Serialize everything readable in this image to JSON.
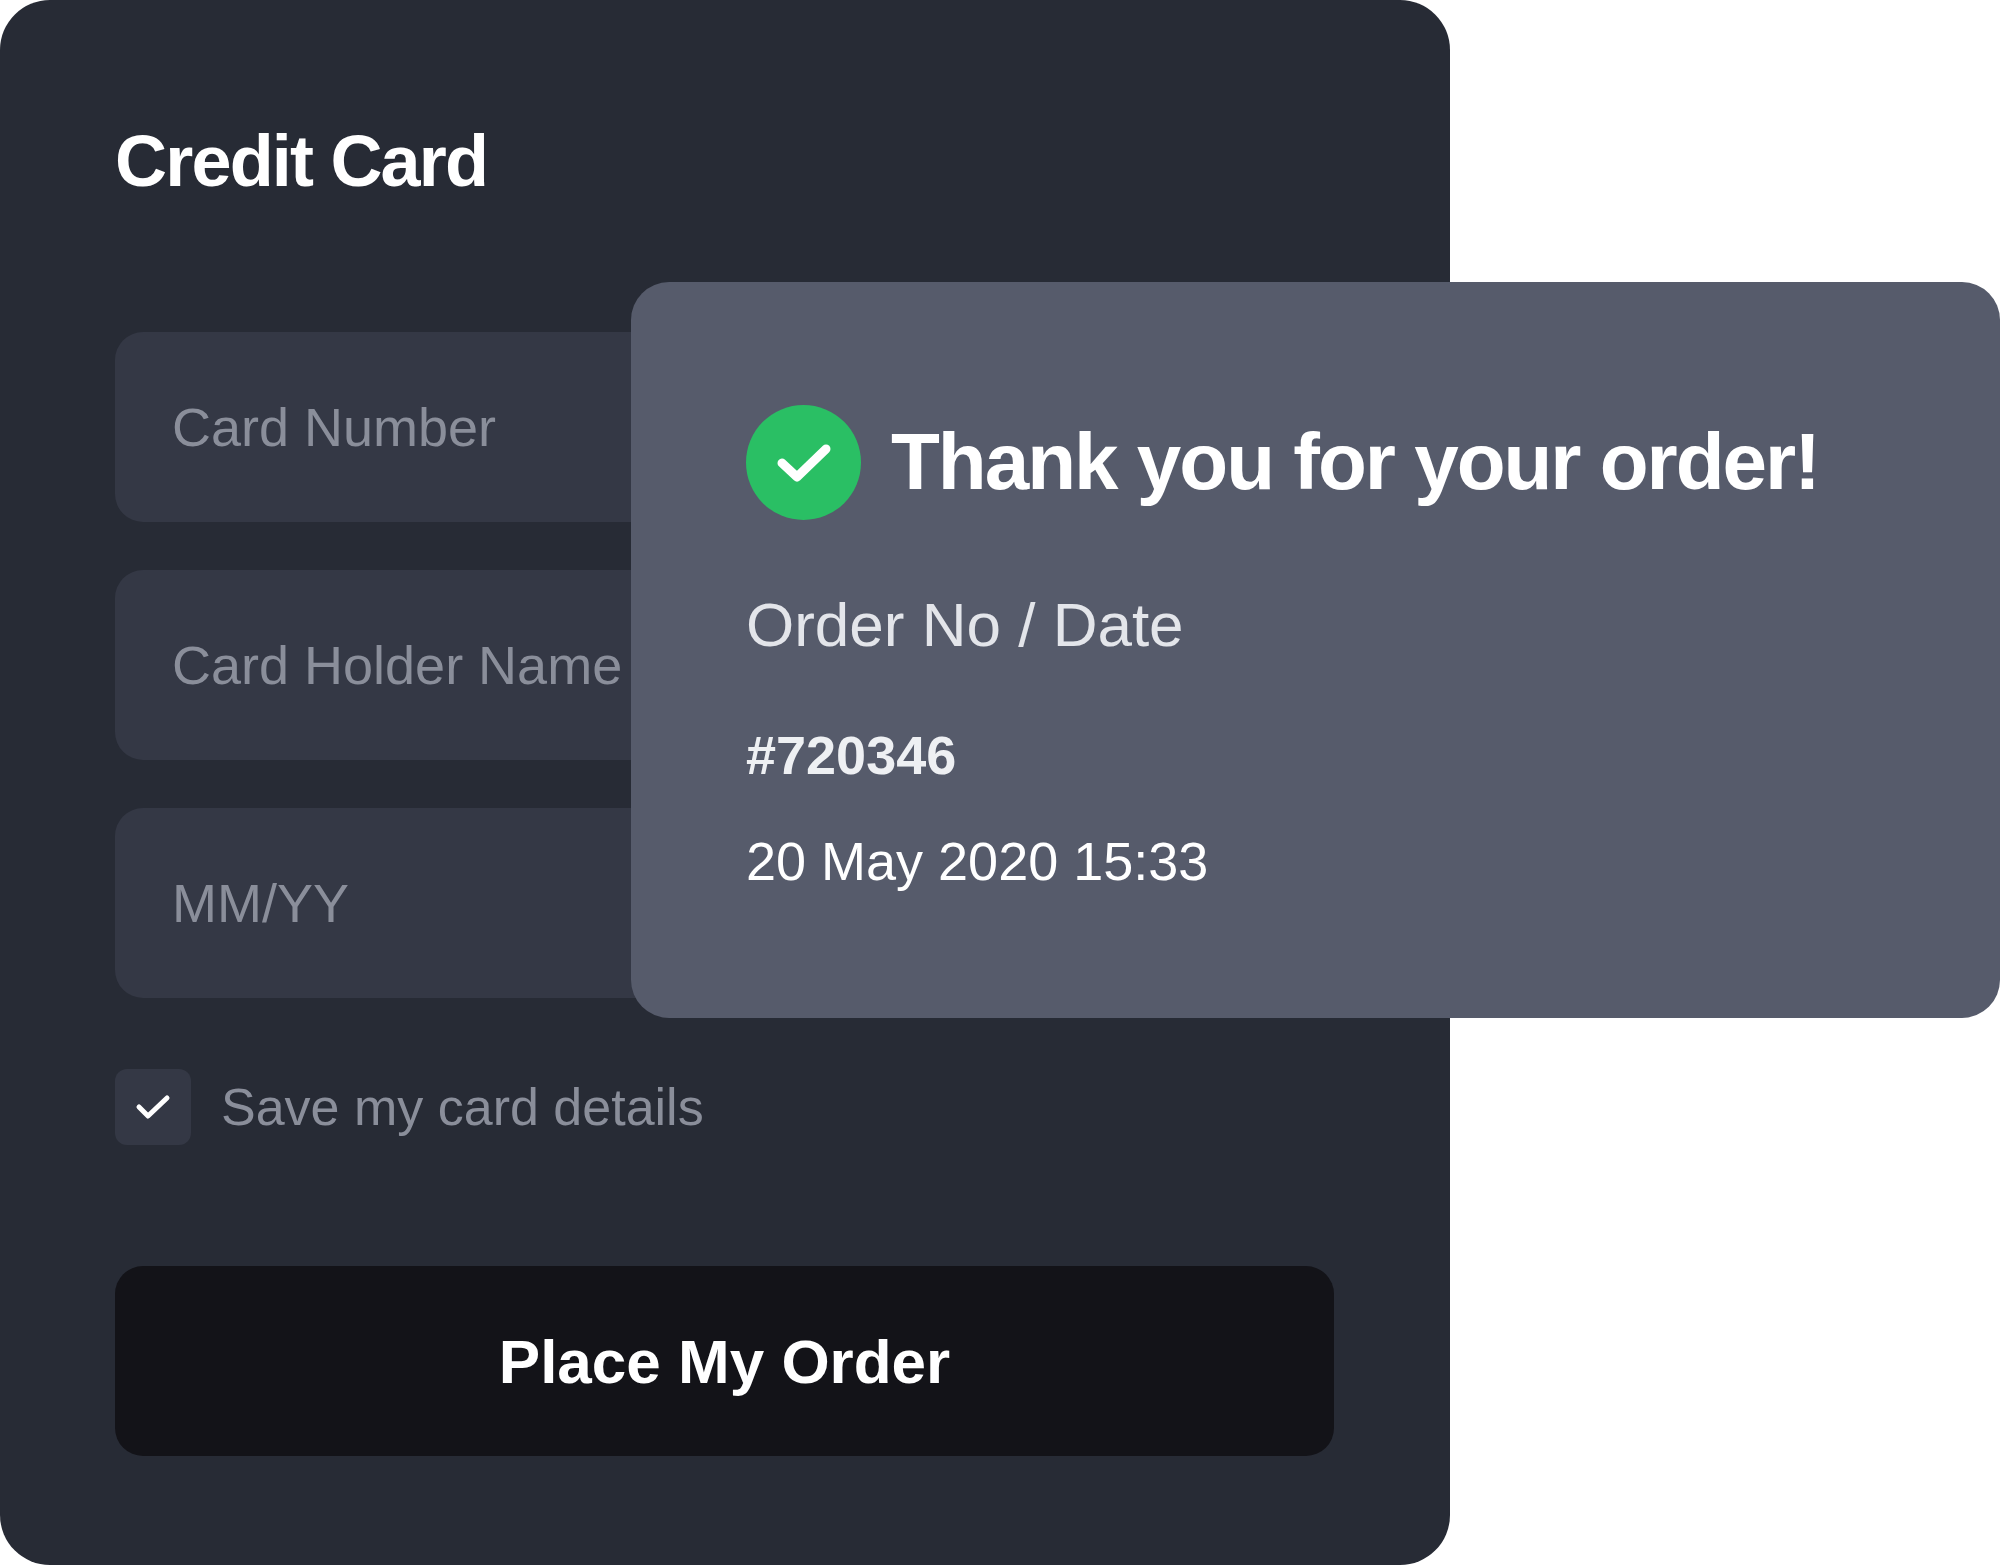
{
  "card": {
    "title": "Credit Card",
    "fields": [
      {
        "placeholder": "Card Number"
      },
      {
        "placeholder": "Card Holder Name"
      },
      {
        "placeholder": "MM/YY"
      }
    ],
    "save_card": {
      "label": "Save my card details",
      "checked": true
    },
    "submit": "Place My Order"
  },
  "confirmation": {
    "heading": "Thank you for your order!",
    "order_label": "Order No / Date",
    "order_number": "#720346",
    "order_date": "20 May 2020 15:33"
  }
}
